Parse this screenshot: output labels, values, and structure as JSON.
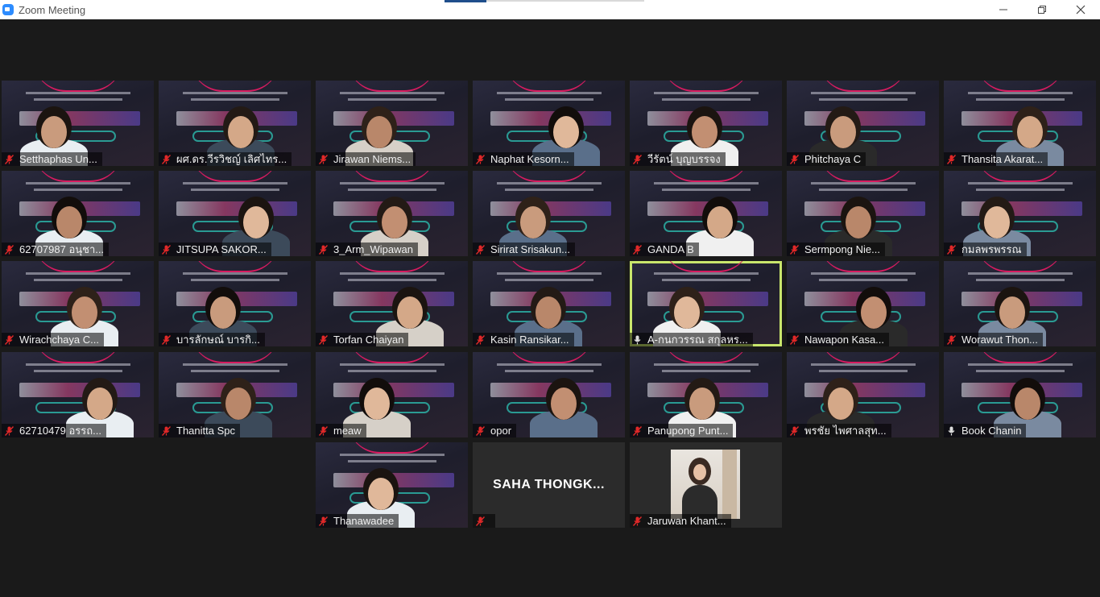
{
  "window": {
    "title": "Zoom Meeting",
    "controls": [
      "minimize-icon",
      "maximize-icon",
      "close-icon"
    ]
  },
  "colors": {
    "background": "#1a1a1a",
    "active_speaker_border": "#c9e66c",
    "muted_icon": "#e02828",
    "slide_accent": "#d81b60"
  },
  "participants": [
    {
      "name": "Setthaphas Un...",
      "muted": true,
      "video": "slide"
    },
    {
      "name": "ผศ.ดร.วีรวิชญ์ เลิศไทร...",
      "muted": true,
      "video": "slide"
    },
    {
      "name": "Jirawan Niems...",
      "muted": true,
      "video": "slide"
    },
    {
      "name": "Naphat Kesorn...",
      "muted": true,
      "video": "slide"
    },
    {
      "name": "วีรัตน์ บุญบรรจง",
      "muted": true,
      "video": "slide"
    },
    {
      "name": "Phitchaya C",
      "muted": true,
      "video": "slide"
    },
    {
      "name": "Thansita Akarat...",
      "muted": true,
      "video": "slide"
    },
    {
      "name": "62707987 อนุชา...",
      "muted": true,
      "video": "slide"
    },
    {
      "name": "JITSUPA SAKOR...",
      "muted": true,
      "video": "slide"
    },
    {
      "name": "3_Arm_Wipawan",
      "muted": true,
      "video": "slide"
    },
    {
      "name": "Sirirat Srisakun...",
      "muted": true,
      "video": "slide"
    },
    {
      "name": "GANDA B",
      "muted": true,
      "video": "slide"
    },
    {
      "name": "Sermpong Nie...",
      "muted": true,
      "video": "slide"
    },
    {
      "name": "กมลพรพรรณ",
      "muted": true,
      "video": "slide"
    },
    {
      "name": "Wirachchaya C...",
      "muted": true,
      "video": "slide"
    },
    {
      "name": "บารลักษณ์ บารกิ...",
      "muted": true,
      "video": "slide"
    },
    {
      "name": "Torfan Chaiyan",
      "muted": true,
      "video": "slide"
    },
    {
      "name": "Kasin Ransikar...",
      "muted": true,
      "video": "slide"
    },
    {
      "name": "A-กนกวรรณ สกุลหร...",
      "muted": false,
      "video": "slide",
      "active": true
    },
    {
      "name": "Nawapon Kasa...",
      "muted": true,
      "video": "slide"
    },
    {
      "name": "Worawut Thon...",
      "muted": true,
      "video": "slide"
    },
    {
      "name": "62710479 อรรถ...",
      "muted": true,
      "video": "slide"
    },
    {
      "name": "Thanitta Spc",
      "muted": true,
      "video": "slide"
    },
    {
      "name": "meaw",
      "muted": true,
      "video": "slide"
    },
    {
      "name": "opor",
      "muted": true,
      "video": "slide"
    },
    {
      "name": "Panupong Punt...",
      "muted": true,
      "video": "slide"
    },
    {
      "name": "พรชัย ไพศาลสุท...",
      "muted": true,
      "video": "slide"
    },
    {
      "name": "Book Chanin",
      "muted": false,
      "video": "slide"
    },
    {
      "name": "Thanawadee",
      "muted": true,
      "video": "slide"
    },
    {
      "name": "",
      "muted": true,
      "video": "off",
      "display_name": "SAHA  THONGK..."
    },
    {
      "name": "Jaruwan Khant...",
      "muted": true,
      "video": "photo"
    }
  ]
}
